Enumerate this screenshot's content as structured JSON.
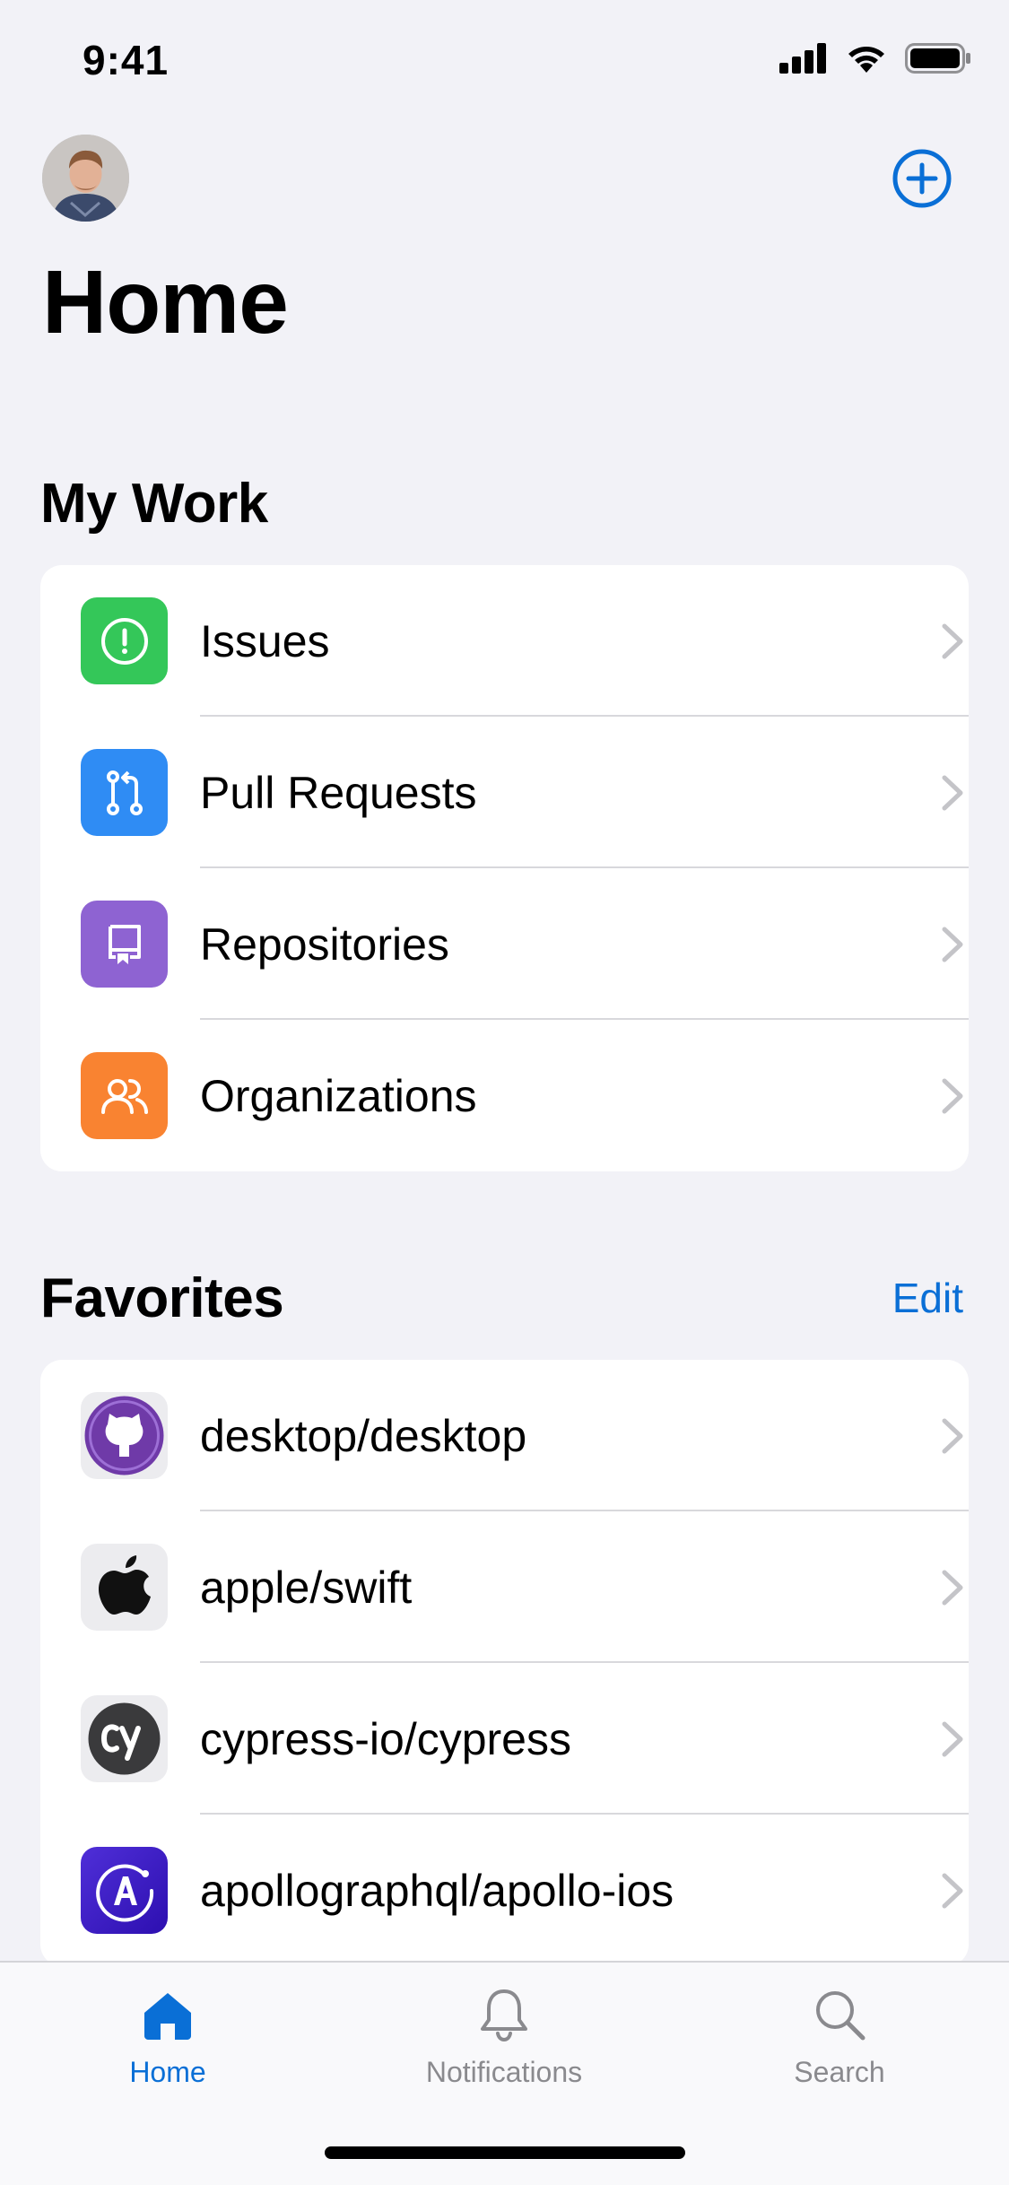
{
  "status_bar": {
    "time": "9:41"
  },
  "header": {
    "title": "Home"
  },
  "my_work": {
    "title": "My Work",
    "items": [
      {
        "label": "Issues",
        "icon": "issue-icon",
        "color": "#34c759"
      },
      {
        "label": "Pull Requests",
        "icon": "pull-request-icon",
        "color": "#2f8cf4"
      },
      {
        "label": "Repositories",
        "icon": "repository-icon",
        "color": "#8e63d2"
      },
      {
        "label": "Organizations",
        "icon": "organization-icon",
        "color": "#f98331"
      }
    ]
  },
  "favorites": {
    "title": "Favorites",
    "edit_label": "Edit",
    "items": [
      {
        "label": "desktop/desktop",
        "icon": "github-desktop-logo-icon"
      },
      {
        "label": "apple/swift",
        "icon": "apple-logo-icon"
      },
      {
        "label": "cypress-io/cypress",
        "icon": "cypress-logo-icon"
      },
      {
        "label": "apollographql/apollo-ios",
        "icon": "apollo-logo-icon"
      }
    ]
  },
  "tab_bar": {
    "tabs": [
      {
        "label": "Home",
        "icon": "home-icon",
        "active": true
      },
      {
        "label": "Notifications",
        "icon": "bell-icon",
        "active": false
      },
      {
        "label": "Search",
        "icon": "search-icon",
        "active": false
      }
    ]
  },
  "colors": {
    "accent": "#0a6fd6",
    "background": "#f2f2f7"
  }
}
